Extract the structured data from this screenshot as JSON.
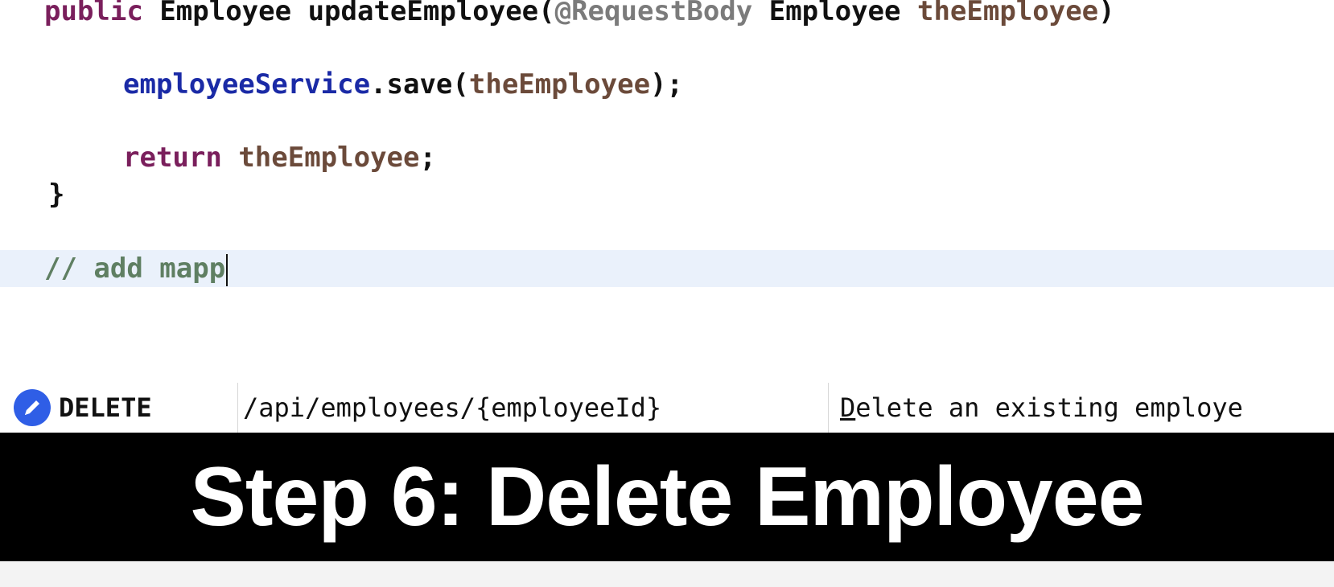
{
  "code": {
    "line1": {
      "kw_public": "public",
      "type": "Employee",
      "method": "updateEmployee(",
      "annotation": "@RequestBody",
      "param_type": "Employee",
      "param_name": "theEmployee",
      "close": ")"
    },
    "line2": {
      "field": "employeeService",
      "call": ".save(",
      "arg": "theEmployee",
      "end": ");"
    },
    "line3": {
      "kw_return": "return",
      "var": "theEmployee",
      "end": ";"
    },
    "line4": {
      "brace": "}"
    },
    "line5": {
      "comment": "// add mapp"
    }
  },
  "completion": {
    "icon": "pencil-icon",
    "method": "DELETE",
    "path": "/api/employees/{employeeId}",
    "desc_mnemonic": "D",
    "desc_rest": "elete an existing employe"
  },
  "caption": {
    "text": "Step 6: Delete Employee"
  },
  "colors": {
    "keyword": "#7a1f5c",
    "field": "#1a2aa6",
    "param": "#6b4a3a",
    "annotation": "#7b7b7b",
    "comment": "#5f7f62",
    "current_line": "#eaf1fb",
    "pencil_badge": "#2f5ee6",
    "caption_bg": "#000000"
  }
}
